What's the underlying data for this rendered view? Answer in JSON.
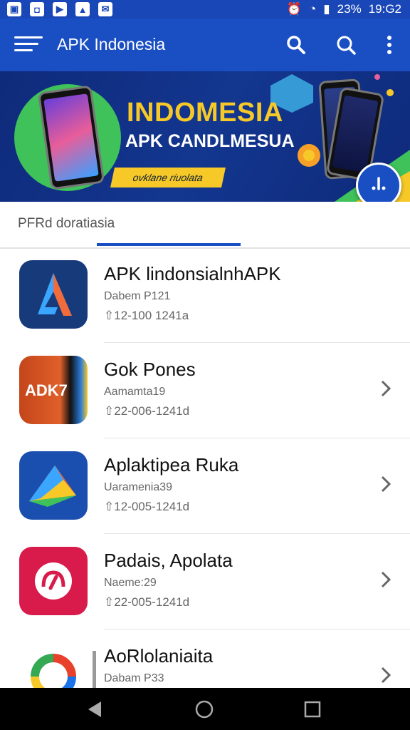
{
  "status_bar": {
    "signal_text": "23%",
    "time": "19:G2"
  },
  "app_bar": {
    "title": "APK Indonesia"
  },
  "banner": {
    "headline": "INDOMESIA",
    "subheadline": "APK CANDLMESUA",
    "tagline": "ovklane riuolata"
  },
  "tabs": {
    "active_label": "PFRd doratiasia"
  },
  "apps": [
    {
      "name": "APK lindonsialnhAPK",
      "sub": "Dabem P121",
      "date": "12-100 1241a",
      "icon_text": ""
    },
    {
      "name": "Gok Pones",
      "sub": "Aamamta19",
      "date": "22-006-1241d",
      "icon_text": "ADK7"
    },
    {
      "name": "Aplaktipea Ruka",
      "sub": "Uaramenia39",
      "date": "12-005-1241d",
      "icon_text": ""
    },
    {
      "name": "Padais, Apolata",
      "sub": "Naeme:29",
      "date": "22-005-1241d",
      "icon_text": ""
    },
    {
      "name": "AoRlolaniaita",
      "sub": "Dabam P33",
      "date": "",
      "icon_text": ""
    }
  ],
  "date_prefix_glyph": "⇧",
  "colors": {
    "primary": "#1a4fc4",
    "banner_accent": "#f6c928"
  }
}
